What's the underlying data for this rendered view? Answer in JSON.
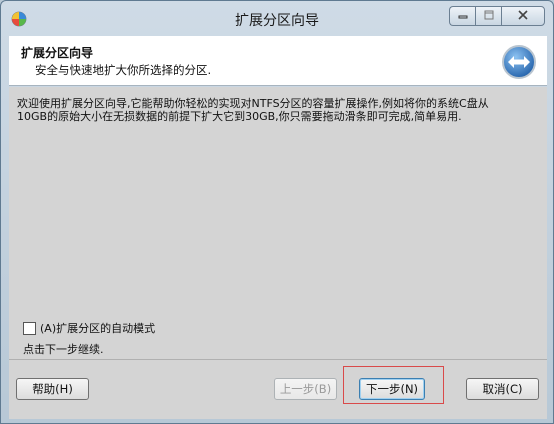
{
  "window": {
    "title": "扩展分区向导"
  },
  "header": {
    "title": "扩展分区向导",
    "subtitle": "安全与快速地扩大你所选择的分区."
  },
  "body": {
    "intro": "欢迎使用扩展分区向导,它能帮助你轻松的实现对NTFS分区的容量扩展操作,例如将你的系统C盘从10GB的原始大小在无损数据的前提下扩大它到30GB,你只需要拖动滑条即可完成,简单易用.",
    "auto_mode_label": "(A)扩展分区的自动模式",
    "auto_mode_checked": false,
    "hint": "点击下一步继续."
  },
  "buttons": {
    "help": "帮助(H)",
    "prev": "上一步(B)",
    "next": "下一步(N)",
    "cancel": "取消(C)"
  },
  "icons": {
    "app": "partition-app-icon",
    "wizard": "expand-arrows-icon",
    "minimize": "minimize-icon",
    "maximize": "maximize-icon",
    "close": "close-icon"
  },
  "colors": {
    "wizard_icon": "#2f76c9",
    "focus_highlight": "#d94a4a"
  }
}
